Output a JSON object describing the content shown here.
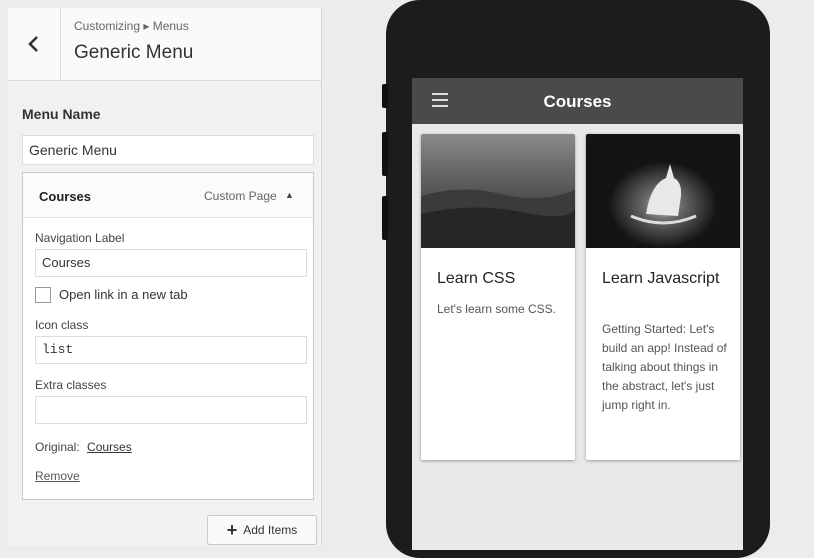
{
  "header": {
    "breadcrumb": "Customizing ▸ Menus",
    "title": "Generic Menu"
  },
  "menu": {
    "name_label": "Menu Name",
    "name_value": "Generic Menu"
  },
  "item": {
    "title": "Courses",
    "type": "Custom Page",
    "navigation_label": "Navigation Label",
    "navigation_value": "Courses",
    "new_tab_label": "Open link in a new tab",
    "new_tab_checked": false,
    "icon_class_label": "Icon class",
    "icon_class_value": "list",
    "extra_classes_label": "Extra classes",
    "extra_classes_value": "",
    "original_label": "Original:",
    "original_link": "Courses",
    "remove_label": "Remove"
  },
  "add_items_label": "Add Items",
  "preview": {
    "app_title": "Courses",
    "cards": [
      {
        "title": "Learn CSS",
        "text": "Let's learn some CSS."
      },
      {
        "title": "Learn Javascript",
        "text": "Getting Started: Let's build an app! Instead of talking about things in the abstract, let's just jump right in."
      }
    ]
  },
  "icons": [
    "chevron-left-icon",
    "chevron-up-icon",
    "plus-icon",
    "hamburger-icon"
  ]
}
